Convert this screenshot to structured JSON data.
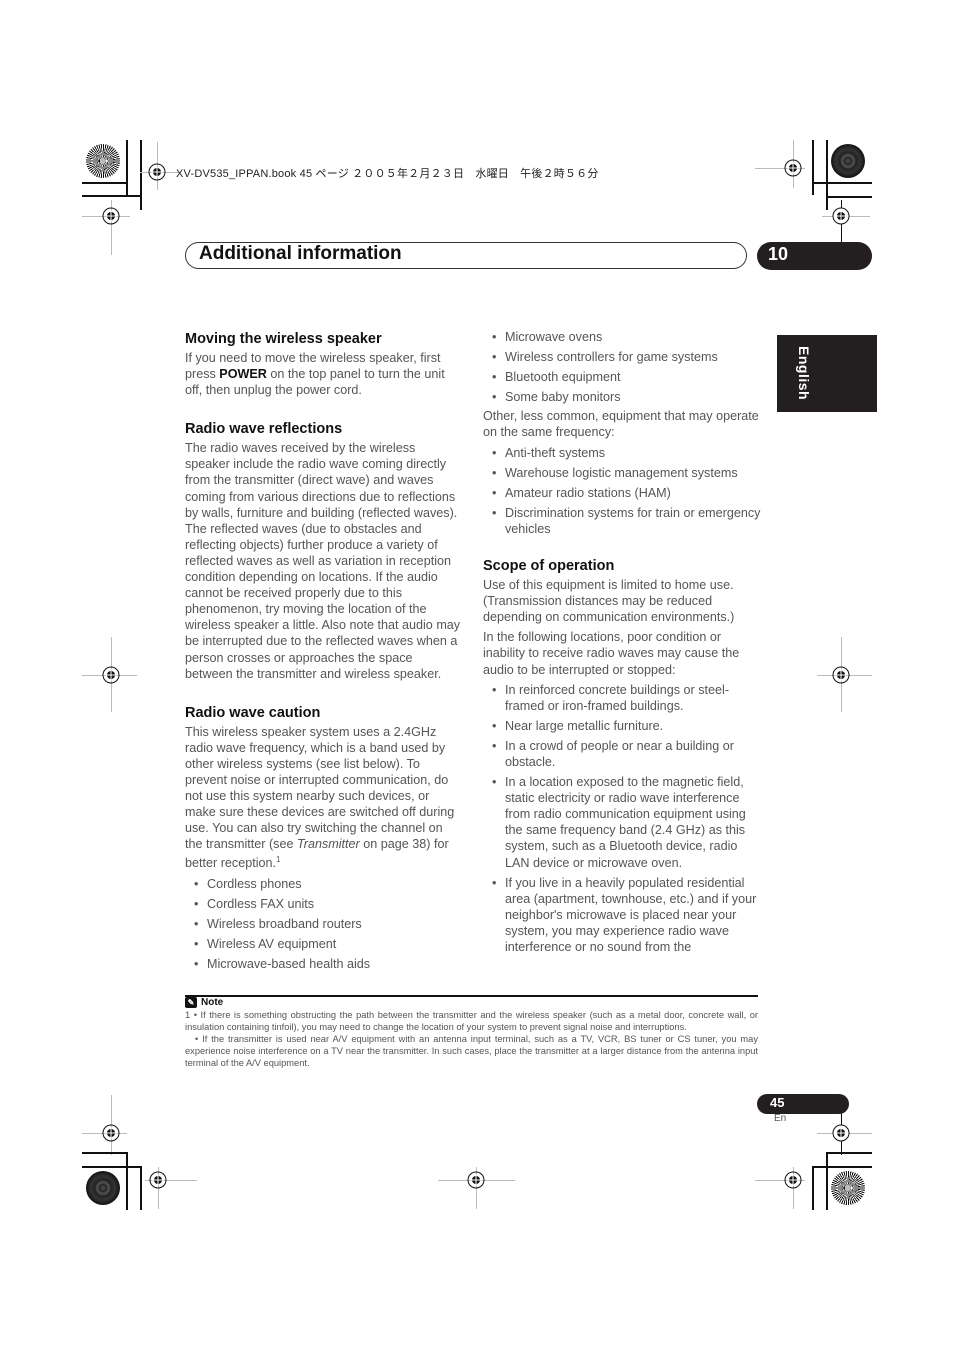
{
  "print_job_line": "XV-DV535_IPPAN.book  45 ページ  ２００５年２月２３日　水曜日　午後２時５６分",
  "header": {
    "title": "Additional information",
    "chapter_number": "10"
  },
  "language_tab": "English",
  "left_column": {
    "moving": {
      "heading": "Moving the wireless speaker",
      "text_before": "If you need to move the wireless speaker, first press ",
      "bold": "POWER",
      "text_after": " on the top panel to turn the unit off, then unplug the power cord."
    },
    "reflections": {
      "heading": "Radio wave reflections",
      "text": "The radio waves received by the wireless speaker include the radio wave coming directly from the transmitter (direct wave) and waves coming from various directions due to reflections by walls, furniture and building (reflected waves). The reflected waves (due to obstacles and reflecting objects) further produce a variety of reflected waves as well as variation in reception condition depending on locations. If the audio cannot be received properly due to this phenomenon, try moving the location of the wireless speaker a little. Also note that audio may be interrupted due to the reflected waves when a person crosses or approaches the space between the transmitter and wireless speaker."
    },
    "caution": {
      "heading": "Radio wave caution",
      "text_before": "This wireless speaker system uses a 2.4GHz radio wave frequency, which is a band used by other wireless systems (see list below). To prevent noise or interrupted communication, do not use this system nearby such devices, or make sure these devices are switched off during use. You can also try switching the channel on the transmitter (see ",
      "italic": "Transmitter",
      "text_after": " on page 38) for better reception.",
      "footnote_ref": "1",
      "items": [
        "Cordless phones",
        "Cordless FAX units",
        "Wireless broadband routers",
        "Wireless AV equipment",
        "Microwave-based health aids"
      ]
    }
  },
  "right_column": {
    "items_continued": [
      "Microwave ovens",
      "Wireless controllers for game systems",
      "Bluetooth equipment",
      "Some baby monitors"
    ],
    "other_intro": "Other, less common, equipment that may operate on the same frequency:",
    "other_items": [
      "Anti-theft systems",
      "Warehouse logistic management systems",
      "Amateur radio stations (HAM)",
      "Discrimination systems for train or emergency vehicles"
    ],
    "scope": {
      "heading": "Scope of operation",
      "para1": "Use of this equipment is limited to home use. (Transmission distances may be reduced depending on communication environments.)",
      "para2": "In the following locations, poor condition or inability to receive radio waves may cause the audio to be interrupted or stopped:",
      "items": [
        "In reinforced concrete buildings or steel-framed or iron-framed buildings.",
        "Near large metallic furniture.",
        "In a crowd of people or near a building or obstacle.",
        "In a location exposed to the magnetic field, static electricity or radio wave interference from radio communication equipment using the same frequency band (2.4 GHz) as this system, such as a Bluetooth device, radio LAN device or microwave oven.",
        "If you live in a heavily populated residential area (apartment, townhouse, etc.) and if your neighbor's microwave is placed near your system, you may experience radio wave interference or no sound from the"
      ]
    }
  },
  "note": {
    "label": "Note",
    "line1": "1  • If there is something obstructing the path between the transmitter and the wireless speaker (such as a metal door, concrete wall, or insulation containing tinfoil), you may need to change the location of your system to prevent signal noise and interruptions.",
    "line2": "• If the transmitter is used near A/V equipment with an antenna input terminal, such as a TV, VCR, BS tuner or CS tuner, you may experience noise interference on a TV near the transmitter. In such cases, place the transmitter at a larger distance from the antenna input terminal of the A/V equipment."
  },
  "footer": {
    "page_number": "45",
    "page_lang": "En"
  }
}
